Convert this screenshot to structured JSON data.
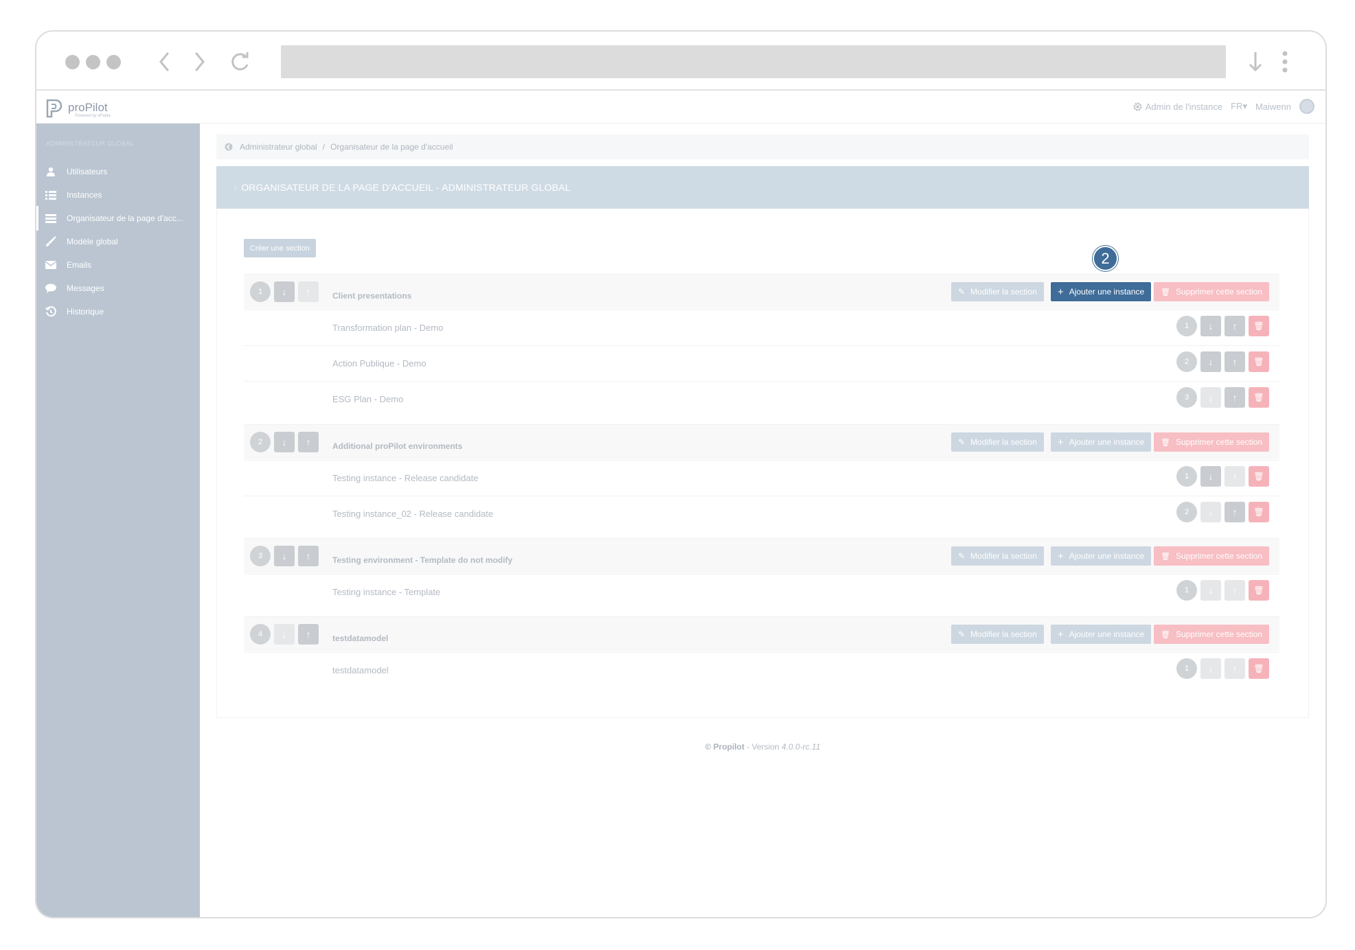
{
  "app": {
    "brand": "proPilot",
    "brand_sub": "Powered by eFakta",
    "topbar": {
      "admin_label": "Admin de l'instance",
      "lang": "FR",
      "user": "Maiwenn"
    }
  },
  "sidebar": {
    "heading": "ADMINISTRATEUR GLOBAL",
    "items": [
      {
        "label": "Utilisateurs",
        "icon": "user-icon"
      },
      {
        "label": "Instances",
        "icon": "list-icon"
      },
      {
        "label": "Organisateur de la page d'acc...",
        "icon": "bars-icon"
      },
      {
        "label": "Modèle global",
        "icon": "brush-icon"
      },
      {
        "label": "Emails",
        "icon": "envelope-icon"
      },
      {
        "label": "Messages",
        "icon": "chat-icon"
      },
      {
        "label": "Historique",
        "icon": "history-icon"
      }
    ]
  },
  "breadcrumb": {
    "root": "Administrateur global",
    "current": "Organisateur de la page d'accueil"
  },
  "panel": {
    "title": "ORGANISATEUR DE LA PAGE D'ACCUEIL - ADMINISTRATEUR GLOBAL",
    "create_label": "Créer une section",
    "edit_label": "Modifier la section",
    "add_label": "Ajouter une instance",
    "delete_label": "Supprimer cette section"
  },
  "sections": [
    {
      "num": "1",
      "title": "Client presentations",
      "items": [
        {
          "num": "1",
          "title": "Transformation plan - Demo"
        },
        {
          "num": "2",
          "title": "Action Publique - Demo"
        },
        {
          "num": "3",
          "title": "ESG Plan - Demo"
        }
      ]
    },
    {
      "num": "2",
      "title": "Additional proPilot environments",
      "items": [
        {
          "num": "1",
          "title": "Testing instance - Release candidate"
        },
        {
          "num": "2",
          "title": "Testing instance_02 - Release candidate"
        }
      ]
    },
    {
      "num": "3",
      "title": "Testing environment - Template do not modify",
      "items": [
        {
          "num": "1",
          "title": "Testing instance - Template"
        }
      ]
    },
    {
      "num": "4",
      "title": "testdatamodel",
      "items": [
        {
          "num": "1",
          "title": "testdatamodel"
        }
      ]
    }
  ],
  "callout": {
    "label": "2"
  },
  "footer": {
    "copyright": "© Propilot",
    "version_prefix": " - Version ",
    "version": "4.0.0-rc.11"
  },
  "colors": {
    "highlight": "#3f6c98",
    "sidebar": "#bac5d1",
    "danger": "#f7bec3"
  }
}
